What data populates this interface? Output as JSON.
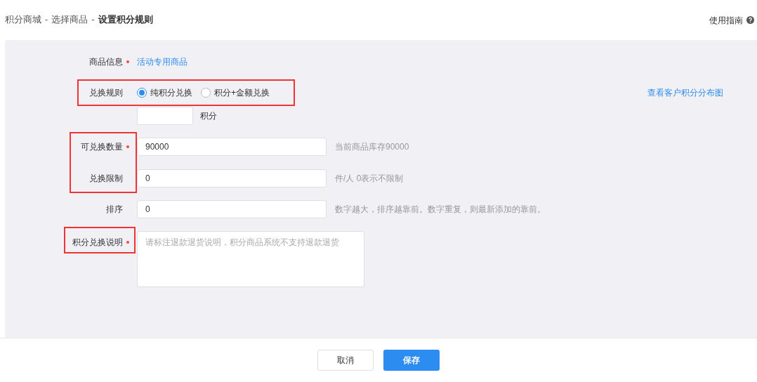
{
  "breadcrumb": [
    {
      "label": "积分商城",
      "current": false
    },
    {
      "label": "选择商品",
      "current": false
    },
    {
      "label": "设置积分规则",
      "current": true
    }
  ],
  "separator": "-",
  "help_link": "使用指南",
  "sections": [
    {
      "kind": "plain",
      "fields": [
        {
          "kind": "link",
          "label": "商品信息",
          "required": true,
          "value": "活动专用商品"
        }
      ]
    },
    {
      "kind": "framed_row",
      "fields": [
        {
          "kind": "radio",
          "label": "兑换规则",
          "required": false,
          "options": [
            {
              "label": "纯积分兑换",
              "selected": true
            },
            {
              "label": "积分+金额兑换",
              "selected": false
            }
          ],
          "aside_link": "查看客户积分分布图"
        }
      ]
    },
    {
      "kind": "plain",
      "fields": [
        {
          "kind": "points",
          "unit": "积分"
        }
      ]
    },
    {
      "kind": "framed_labels",
      "fields": [
        {
          "kind": "input",
          "label": "可兑换数量",
          "required": true,
          "value": "90000",
          "hint": "当前商品库存90000"
        },
        {
          "kind": "input",
          "label": "兑换限制",
          "required": false,
          "value": "0",
          "hint": "件/人 0表示不限制"
        }
      ]
    },
    {
      "kind": "plain",
      "fields": [
        {
          "kind": "input",
          "label": "排序",
          "required": false,
          "value": "0",
          "hint": "数字越大，排序越靠前。数字重复，则最新添加的靠前。"
        }
      ]
    },
    {
      "kind": "framed_labels",
      "fields": [
        {
          "kind": "textarea",
          "label": "积分兑换说明",
          "required": true,
          "placeholder": "请标注退款退货说明，积分商品系统不支持退款退货"
        }
      ]
    }
  ],
  "buttons": [
    {
      "label": "取消",
      "kind": "secondary"
    },
    {
      "label": "保存",
      "kind": "primary"
    }
  ]
}
